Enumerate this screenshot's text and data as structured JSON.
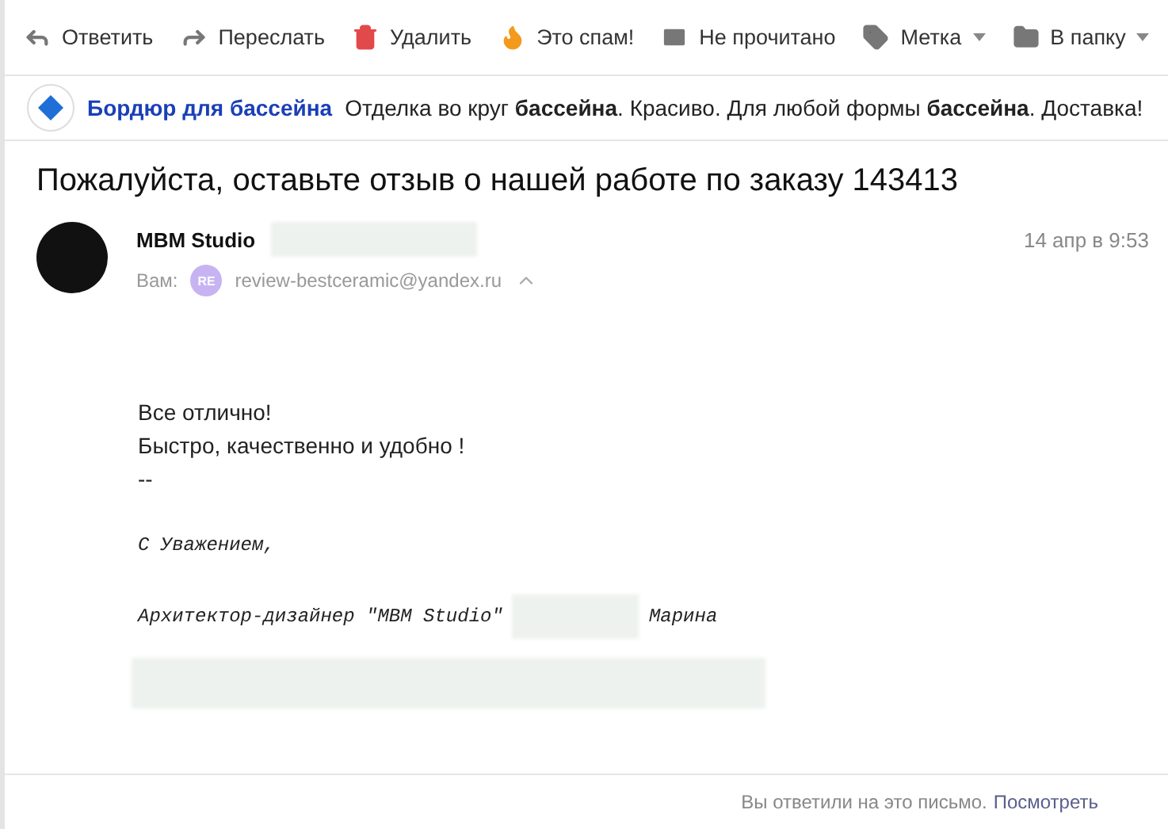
{
  "toolbar": [
    {
      "kind": "reply",
      "label": "Ответить",
      "menu": false
    },
    {
      "kind": "forward",
      "label": "Переслать",
      "menu": false
    },
    {
      "kind": "delete",
      "label": "Удалить",
      "menu": false
    },
    {
      "kind": "spam",
      "label": "Это спам!",
      "menu": false
    },
    {
      "kind": "unread",
      "label": "Не прочитано",
      "menu": false
    },
    {
      "kind": "label",
      "label": "Метка",
      "menu": true
    },
    {
      "kind": "folder",
      "label": "В папку",
      "menu": true
    }
  ],
  "ad": {
    "title": "Бордюр для бассейна",
    "text": "Отделка во круг **бассейна**. Красиво. Для любой формы **бассейна**. Доставка!"
  },
  "subject": "Пожалуйста, оставьте отзыв о нашей работе по заказу 143413",
  "sender": {
    "name": "MBM Studio",
    "date": "14 апр в 9:53",
    "to_label": "Вам:",
    "recipient_initials": "RE",
    "recipient_email": "review-bestceramic@yandex.ru"
  },
  "body": {
    "lines": [
      "Все отлично!",
      "Быстро, качественно и удобно !",
      "--"
    ],
    "signature": [
      "С Уважением,",
      "Архитектор-дизайнер \"MBM Studio\""
    ],
    "signature_name": "Марина"
  },
  "footer": {
    "text": "Вы ответили на это письмо.",
    "link": "Посмотреть"
  }
}
